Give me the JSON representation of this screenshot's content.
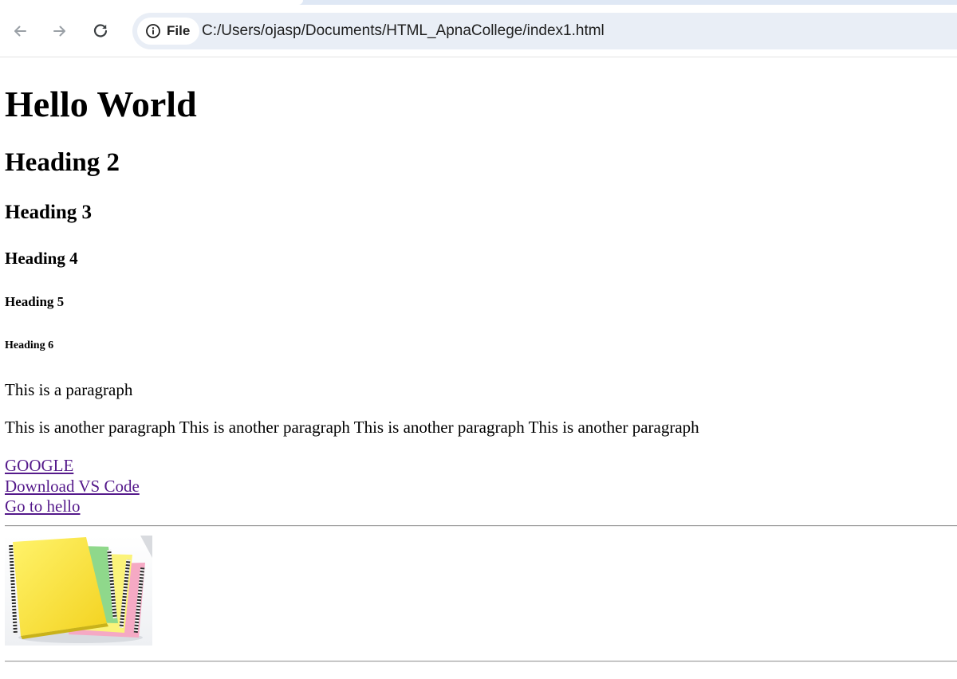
{
  "browser": {
    "security_chip_label": "File",
    "url": "C:/Users/ojasp/Documents/HTML_ApnaCollege/index1.html",
    "icons": {
      "back": "arrow-left-icon",
      "forward": "arrow-right-icon",
      "reload": "reload-icon",
      "info": "info-icon"
    }
  },
  "page": {
    "h1": "Hello World",
    "h2": "Heading 2",
    "h3": "Heading 3",
    "h4": "Heading 4",
    "h5": "Heading 5",
    "h6": "Heading 6",
    "paragraphs": [
      "This is a paragraph",
      "This is another paragraph This is another paragraph This is another paragraph This is another paragraph"
    ],
    "links": [
      "GOOGLE",
      "Download VS Code",
      "Go to hello"
    ],
    "image": {
      "subject": "stack of spiral notebooks"
    }
  },
  "colors": {
    "visited_link": "#551a8b",
    "omnibox_background": "#e9eef6",
    "toolbar_icon": "#5f6368"
  }
}
